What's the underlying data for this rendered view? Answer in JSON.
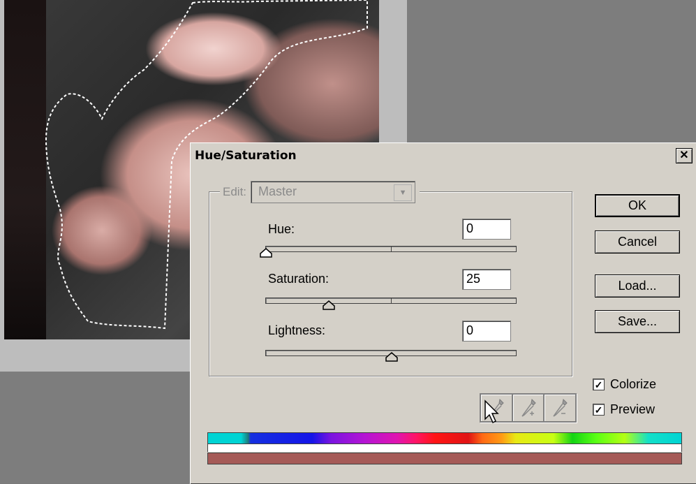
{
  "dialog": {
    "title": "Hue/Saturation",
    "close_label": "✕",
    "edit": {
      "label": "Edit:",
      "value": "Master"
    },
    "sliders": {
      "hue": {
        "label": "Hue:",
        "value": "0",
        "level": 0
      },
      "saturation": {
        "label": "Saturation:",
        "value": "25",
        "level": 25
      },
      "lightness": {
        "label": "Lightness:",
        "value": "0",
        "level": 0
      }
    },
    "buttons": {
      "ok": "OK",
      "cancel": "Cancel",
      "load": "Load...",
      "save": "Save..."
    },
    "checkboxes": {
      "colorize": {
        "label": "Colorize",
        "checked": true
      },
      "preview": {
        "label": "Preview",
        "checked": true
      }
    },
    "colorize_result_color": "#a55a57"
  }
}
